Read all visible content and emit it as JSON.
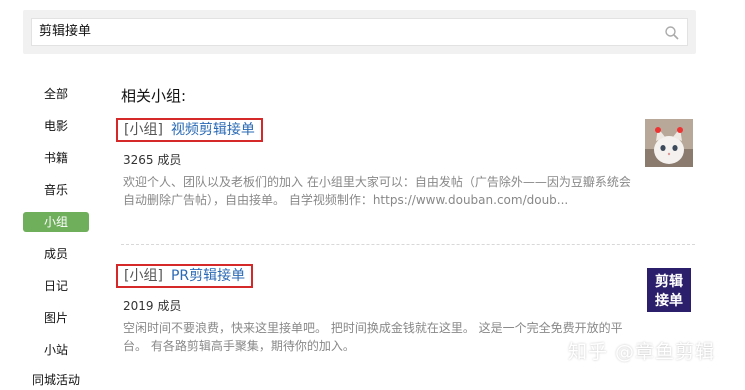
{
  "search": {
    "value": "剪辑接单"
  },
  "sidebar": {
    "items": [
      {
        "label": "全部"
      },
      {
        "label": "电影"
      },
      {
        "label": "书籍"
      },
      {
        "label": "音乐"
      },
      {
        "label": "小组"
      },
      {
        "label": "成员"
      },
      {
        "label": "日记"
      },
      {
        "label": "图片"
      },
      {
        "label": "小站"
      },
      {
        "label": "同城活动"
      }
    ],
    "active_index": 4
  },
  "main": {
    "heading": "相关小组:",
    "results": [
      {
        "tag": "[小组]",
        "name": "视频剪辑接单",
        "members": "3265 成员",
        "desc": "欢迎个人、团队以及老板们的加入 在小组里大家可以：自由发帖（广告除外——因为豆瓣系统会自动删除广告帖），自由接单。 自学视频制作：https://www.douban.com/doub..."
      },
      {
        "tag": "[小组]",
        "name": "PR剪辑接单",
        "members": "2019 成员",
        "desc": "空闲时间不要浪费，快来这里接单吧。 把时间换成金钱就在这里。 这是一个完全免费开放的平台。 有各路剪辑高手聚集，期待你的加入。",
        "thumb_text": [
          "剪辑",
          "接单"
        ]
      }
    ]
  },
  "watermark": "知乎 @章鱼剪辑",
  "colors": {
    "active": "#6fae5b",
    "link": "#2a6ab5",
    "highlight": "#d52828"
  }
}
